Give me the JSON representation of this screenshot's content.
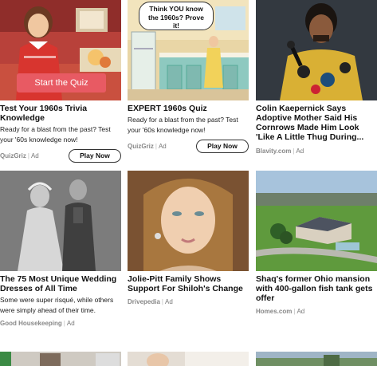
{
  "cards": [
    {
      "title": "Test Your 1960s Trivia Knowledge",
      "description": "Ready for a blast from the past? Test your '60s knowledge now!",
      "source": "QuizGriz",
      "ad_label": "Ad",
      "cta": "Play Now",
      "overlay_button": "Start the Quiz"
    },
    {
      "title": "EXPERT 1960s Quiz",
      "description": "Ready for a blast from the past? Test your '60s knowledge now!",
      "source": "QuizGriz",
      "ad_label": "Ad",
      "cta": "Play Now",
      "bubble_lines": [
        "Think YOU know",
        "the 1960s? Prove",
        "it!"
      ]
    },
    {
      "title": "Colin Kaepernick Says Adoptive Mother Said His Cornrows Made Him Look 'Like A Little Thug During...",
      "source": "Blavity.com",
      "ad_label": "Ad"
    },
    {
      "title": "The 75 Most Unique Wedding Dresses of All Time",
      "description": "Some were super risqué, while others were simply ahead of their time.",
      "source": "Good Housekeeping",
      "ad_label": "Ad"
    },
    {
      "title": "Jolie-Pitt Family Shows Support For Shiloh's Change",
      "source": "Drivepedia",
      "ad_label": "Ad"
    },
    {
      "title": "Shaq's former Ohio mansion with 400-gallon fish tank gets offer",
      "source": "Homes.com",
      "ad_label": "Ad"
    }
  ],
  "colors": {
    "quiz_button": "#e85a63",
    "title_text": "#111111",
    "meta_text": "#777777"
  }
}
